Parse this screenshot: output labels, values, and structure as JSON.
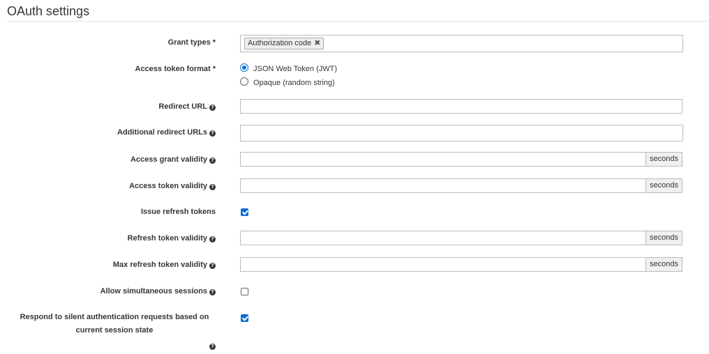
{
  "section": {
    "title": "OAuth settings"
  },
  "help_glyph": "?",
  "required_marker": "*",
  "fields": {
    "grant_types": {
      "label": "Grant types",
      "tags": [
        "Authorization code"
      ],
      "tag_remove_glyph": "✖"
    },
    "access_token_format": {
      "label": "Access token format",
      "options": [
        {
          "label": "JSON Web Token (JWT)",
          "checked": true
        },
        {
          "label": "Opaque (random string)",
          "checked": false
        }
      ]
    },
    "redirect_url": {
      "label": "Redirect URL",
      "value": ""
    },
    "additional_redirect_urls": {
      "label": "Additional redirect URLs",
      "value": ""
    },
    "access_grant_validity": {
      "label": "Access grant validity",
      "value": "",
      "unit": "seconds"
    },
    "access_token_validity": {
      "label": "Access token validity",
      "value": "",
      "unit": "seconds"
    },
    "issue_refresh_tokens": {
      "label": "Issue refresh tokens",
      "checked": true
    },
    "refresh_token_validity": {
      "label": "Refresh token validity",
      "value": "",
      "unit": "seconds"
    },
    "max_refresh_token_validity": {
      "label": "Max refresh token validity",
      "value": "",
      "unit": "seconds"
    },
    "allow_simultaneous_sessions": {
      "label": "Allow simultaneous sessions",
      "checked": false
    },
    "respond_silent_auth": {
      "label": "Respond to silent authentication requests based on current session state",
      "checked": true
    }
  },
  "colors": {
    "accent": "#0b6fd6",
    "border": "#bbbbbb",
    "addon_bg": "#f0f0f0",
    "label_text": "#363636"
  }
}
